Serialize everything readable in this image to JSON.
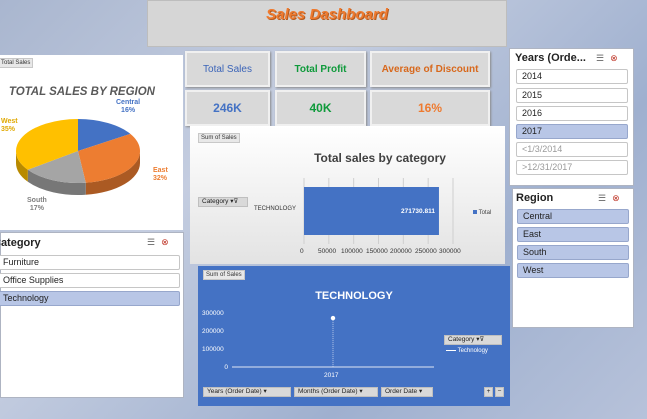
{
  "dashboard": {
    "title": "Sales Dashboard"
  },
  "kpis": [
    {
      "label": "Total Sales",
      "value": "246K",
      "label_color": "#3b64b8",
      "value_color": "#4472c4"
    },
    {
      "label": "Total Profit",
      "value": "40K",
      "label_color": "#0f9a3b",
      "value_color": "#0f9a3b"
    },
    {
      "label": "Average of Discount",
      "value": "16%",
      "label_color": "#d8681c",
      "value_color": "#ee7a2f"
    }
  ],
  "pie_panel": {
    "tag": "Total Sales",
    "chart_data": {
      "type": "pie",
      "title": "TOTAL SALES BY REGION",
      "categories": [
        "Central",
        "East",
        "South",
        "West"
      ],
      "values": [
        16,
        32,
        17,
        35
      ],
      "labels": [
        "16%",
        "32%",
        "17%",
        "35%"
      ],
      "colors": [
        "#4472c4",
        "#ed7d31",
        "#a5a5a5",
        "#ffc000"
      ]
    }
  },
  "category_slicer": {
    "header": "Category",
    "items": [
      {
        "label": "Furniture",
        "selected": false
      },
      {
        "label": "Office Supplies",
        "selected": false
      },
      {
        "label": "Technology",
        "selected": true
      }
    ]
  },
  "years_slicer": {
    "header": "Years (Orde...",
    "items": [
      {
        "label": "2014",
        "selected": false
      },
      {
        "label": "2015",
        "selected": false
      },
      {
        "label": "2016",
        "selected": false
      },
      {
        "label": "2017",
        "selected": true
      },
      {
        "label": "<1/3/2014",
        "selected": false
      },
      {
        "label": ">12/31/2017",
        "selected": false
      }
    ]
  },
  "region_slicer": {
    "header": "Region",
    "items": [
      {
        "label": "Central",
        "selected": true
      },
      {
        "label": "East",
        "selected": true
      },
      {
        "label": "South",
        "selected": true
      },
      {
        "label": "West",
        "selected": true
      }
    ]
  },
  "bar_panel": {
    "tag": "Sum of Sales",
    "filter_button": "Category",
    "legend": "Total",
    "chart_data": {
      "type": "bar",
      "title": "Total sales by category",
      "categories": [
        "TECHNOLOGY"
      ],
      "values": [
        271730.811
      ],
      "data_labels": [
        "271730.811"
      ],
      "xlim": [
        0,
        300000
      ],
      "ticks": [
        "0",
        "50000",
        "100000",
        "150000",
        "200000",
        "250000",
        "300000"
      ],
      "bar_color": "#4472c4"
    }
  },
  "line_panel": {
    "tag": "Sum of Sales",
    "legend_button": "Category",
    "legend": "Technology",
    "field_buttons": [
      "Years (Order Date)",
      "Months (Order Date)",
      "Order Date"
    ],
    "expand": "+",
    "collapse": "−",
    "chart_data": {
      "type": "line",
      "title": "TECHNOLOGY",
      "categories": [
        "2017"
      ],
      "series": [
        {
          "name": "Technology",
          "values": [
            271730.811
          ]
        }
      ],
      "ylim": [
        0,
        300000
      ],
      "ticks": [
        "0",
        "100000",
        "200000",
        "300000"
      ]
    }
  }
}
